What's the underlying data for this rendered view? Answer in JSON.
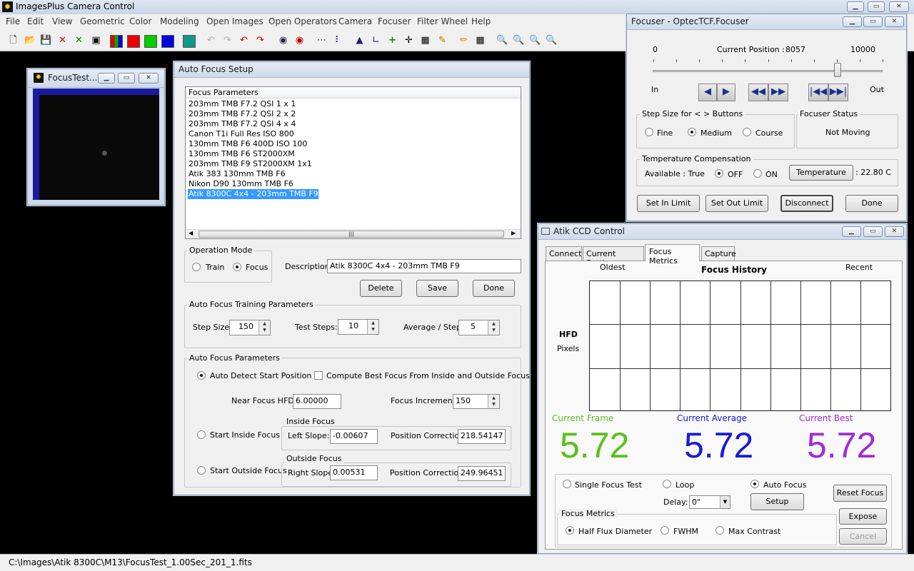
{
  "app": {
    "title": "ImagesPlus Camera Control",
    "menu": [
      "File",
      "Edit",
      "View",
      "Geometric",
      "Color",
      "Modeling",
      "Open Images",
      "Open Operators",
      "Camera",
      "Focuser",
      "Filter Wheel",
      "Help"
    ],
    "status_path": "C:\\Images\\Atik 8300C\\M13\\FocusTest_1.00Sec_201_1.fits"
  },
  "focus_test": {
    "title": "FocusTest..."
  },
  "autofocus": {
    "title": "Auto Focus Setup",
    "list_header": "Focus Parameters",
    "items": [
      "203mm TMB F7.2 QSI 1 x 1",
      "203mm TMB F7.2 QSI 2 x 2",
      "203mm TMB F7.2 QSI 4 x 4",
      "Canon T1i Full Res ISO 800",
      "130mm TMB F6 400D ISO 100",
      "130mm TMB F6 ST2000XM",
      "203mm TMB F9 ST2000XM 1x1",
      "Atik 383 130mm TMB F6",
      "Nikon D90 130mm TMB F6",
      "Atik 8300C 4x4 - 203mm TMB F9"
    ],
    "op_mode_label": "Operation Mode",
    "train_label": "Train",
    "focus_label": "Focus",
    "description_label": "Description:",
    "description_value": "Atik 8300C 4x4 - 203mm TMB F9",
    "delete_label": "Delete",
    "save_label": "Save",
    "done_label": "Done",
    "training_label": "Auto Focus Training Parameters",
    "step_size_label": "Step Size:",
    "step_size_value": "150",
    "test_steps_label": "Test Steps:",
    "test_steps_value": "10",
    "avg_step_label": "Average / Step:",
    "avg_step_value": "5",
    "params_label": "Auto Focus Parameters",
    "auto_detect_label": "Auto Detect Start Position",
    "compute_best_label": "Compute Best Focus From Inside and Outside Focus",
    "near_hfd_label": "Near Focus HFD:",
    "near_hfd_value": "6.00000",
    "focus_inc_label": "Focus Increment:",
    "focus_inc_value": "150",
    "start_inside_label": "Start Inside Focus",
    "inside_focus_label": "Inside Focus",
    "left_slope_label": "Left Slope:",
    "left_slope_value": "-0.00607",
    "inside_pos_corr_label": "Position Correction:",
    "inside_pos_corr_value": "218.54147",
    "start_outside_label": "Start Outside Focus",
    "outside_focus_label": "Outside Focus",
    "right_slope_label": "Right Slope:",
    "right_slope_value": "0.00531",
    "outside_pos_corr_label": "Position Correction:",
    "outside_pos_corr_value": "249.96451"
  },
  "focuser": {
    "title": "Focuser - OptecTCF.Focuser",
    "min": "0",
    "current_label": "Current Position :",
    "current_value": "8057",
    "max": "10000",
    "slider_fraction": 0.8057,
    "in_label": "In",
    "out_label": "Out",
    "step_size_label": "Step Size for < > Buttons",
    "fine_label": "Fine",
    "medium_label": "Medium",
    "course_label": "Course",
    "status_label": "Focuser Status",
    "status_value": "Not Moving",
    "temp_comp_label": "Temperature Compensation",
    "available_label": "Available : True",
    "off_label": "OFF",
    "on_label": "ON",
    "temperature_button": "Temperature",
    "temperature_value": ": 22.80 C",
    "set_in_limit": "Set In Limit",
    "set_out_limit": "Set Out Limit",
    "disconnect": "Disconnect",
    "done": "Done"
  },
  "ccd": {
    "title": "Atik CCD Control",
    "tabs": [
      "Connect",
      "Current Settings",
      "Focus Metrics",
      "Capture"
    ],
    "oldest_label": "Oldest",
    "history_label": "Focus History",
    "recent_label": "Recent",
    "hfd_label": "HFD",
    "pixels_label": "Pixels",
    "current_frame_label": "Current Frame",
    "current_frame_value": "5.72",
    "current_average_label": "Current Average",
    "current_average_value": "5.72",
    "current_best_label": "Current Best",
    "current_best_value": "5.72",
    "single_focus_label": "Single Focus Test",
    "loop_label": "Loop",
    "auto_focus_label": "Auto Focus",
    "delay_label": "Delay:",
    "delay_value": "0\"",
    "setup_label": "Setup",
    "reset_focus_label": "Reset Focus",
    "expose_label": "Expose",
    "cancel_label": "Cancel",
    "metrics_label": "Focus Metrics",
    "hfd_option_label": "Half Flux Diameter",
    "fwhm_label": "FWHM",
    "max_contrast_label": "Max Contrast",
    "colors": {
      "frame": "#5cbe1f",
      "average": "#1a1ad8",
      "best": "#a02bd8"
    }
  }
}
